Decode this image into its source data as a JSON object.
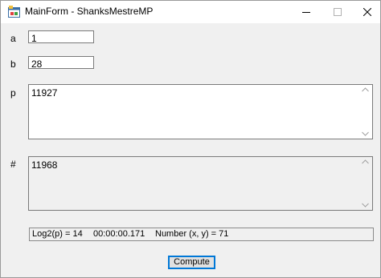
{
  "window": {
    "title": "MainForm - ShanksMestreMP",
    "icon": "winforms-app-icon"
  },
  "fields": {
    "a": {
      "label": "a",
      "value": "1"
    },
    "b": {
      "label": "b",
      "value": "28"
    },
    "p": {
      "label": "p",
      "value": "11927"
    },
    "hash": {
      "label": "#",
      "value": "11968"
    }
  },
  "status": {
    "log2": "Log2(p) = 14",
    "time": "00:00:00.171",
    "number": "Number (x, y) = 71"
  },
  "compute_label": "Compute",
  "colors": {
    "accent": "#0078d7",
    "form_bg": "#f0f0f0",
    "readonly_bg": "#f0f0f0"
  }
}
